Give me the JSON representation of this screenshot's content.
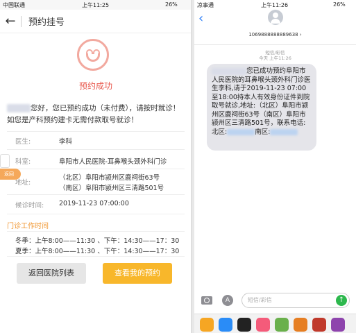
{
  "left": {
    "status": {
      "carrier": "中国联通",
      "time": "上午11:25",
      "battery": "26%"
    },
    "nav": {
      "back": "←",
      "title": "预约挂号"
    },
    "success": "预约成功",
    "message": "您好，您已预约成功（未付费），请按时就诊！如您是产科预约建卡无需付款取号就诊！",
    "fields": [
      {
        "label": "医生:",
        "value": "李科"
      },
      {
        "label": "科室:",
        "value": "阜阳市人民医院-耳鼻喉头颈外科门诊"
      },
      {
        "label": "地址:",
        "value": "（北区）阜阳市颍州区鹿祠街63号"
      },
      {
        "label": "",
        "value": "（南区）阜阳市颍州区三清路501号"
      },
      {
        "label": "候诊时间:",
        "value": "2019-11-23 07:00:00"
      }
    ],
    "work_time_title": "门诊工作时间",
    "winter": "冬季：上午8:00——11:30 、下午：14:30——17：30",
    "summer": "夏季：上午8:00——11:30 、下午：14:30——17：30",
    "float_label": "返回",
    "btn_back": "返回医院列表",
    "btn_view": "查看我的预约"
  },
  "right": {
    "status": {
      "carrier": "凉事通",
      "time": "上午11:26",
      "battery": "26%"
    },
    "number": "1069888888889638",
    "chevron": "›",
    "type": "短信/彩信",
    "time": "今天 上午11:26",
    "sms": "您已成功预约阜阳市人民医院的耳鼻喉头颈外科门诊医生李科,请于2019-11-23 07:00至18:00持本人有效身份证件到院取号就诊,地址:（北区）阜阳市颍州区鹿祠街63号（南区）阜阳市颍州区三清路501号，联系电话:北区:",
    "sms_tail_south": "南区:",
    "placeholder": "短信/彩信",
    "send": "↑",
    "astore": "A"
  }
}
